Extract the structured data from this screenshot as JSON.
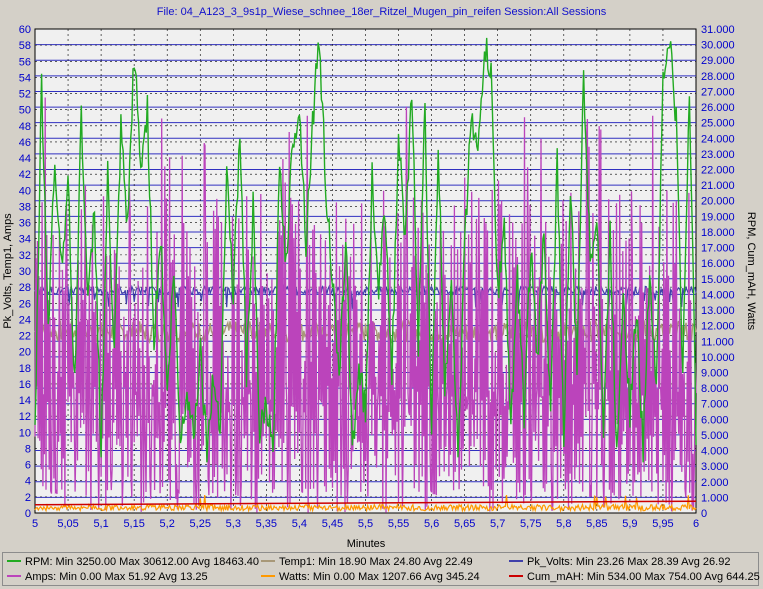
{
  "title": "File: 04_A123_3_9s1p_Wiese_schnee_18er_Ritzel_Mugen_pin_reifen   Session:All Sessions",
  "chart_data": {
    "type": "line",
    "xlabel": "Minutes",
    "ylabel_left": "Pk_Volts, Temp1, Amps",
    "ylabel_right": "RPM, Cum_mAH, Watts",
    "xlim": [
      5,
      6
    ],
    "ylim_left": [
      0,
      60
    ],
    "ylim_right": [
      0,
      31000
    ],
    "x_ticks": [
      "5",
      "5,05",
      "5,1",
      "5,15",
      "5,2",
      "5,25",
      "5,3",
      "5,35",
      "5,4",
      "5,45",
      "5,5",
      "5,55",
      "5,6",
      "5,65",
      "5,7",
      "5,75",
      "5,8",
      "5,85",
      "5,9",
      "5,95",
      "6"
    ],
    "y_left_ticks": [
      "0",
      "2",
      "4",
      "6",
      "8",
      "10",
      "12",
      "14",
      "16",
      "18",
      "20",
      "22",
      "24",
      "26",
      "28",
      "30",
      "32",
      "34",
      "36",
      "38",
      "40",
      "42",
      "44",
      "46",
      "48",
      "50",
      "52",
      "54",
      "56",
      "58",
      "60"
    ],
    "y_right_ticks": [
      "0",
      "1.000",
      "2.000",
      "3.000",
      "4.000",
      "5.000",
      "6.000",
      "7.000",
      "8.000",
      "9.000",
      "10.000",
      "11.000",
      "12.000",
      "13.000",
      "14.000",
      "15.000",
      "16.000",
      "17.000",
      "18.000",
      "19.000",
      "20.000",
      "21.000",
      "22.000",
      "23.000",
      "24.000",
      "25.000",
      "26.000",
      "27.000",
      "28.000",
      "29.000",
      "30.000",
      "31.000"
    ],
    "grid": true,
    "series": [
      {
        "name": "RPM",
        "axis": "right",
        "color": "#22aa22",
        "x": [
          5.0,
          5.01,
          5.02,
          5.03,
          5.04,
          5.05,
          5.06,
          5.07,
          5.08,
          5.09,
          5.1,
          5.11,
          5.12,
          5.13,
          5.14,
          5.15,
          5.16,
          5.17,
          5.18,
          5.19,
          5.2,
          5.21,
          5.22,
          5.23,
          5.24,
          5.25,
          5.26,
          5.27,
          5.28,
          5.29,
          5.3,
          5.31,
          5.32,
          5.33,
          5.34,
          5.35,
          5.36,
          5.37,
          5.38,
          5.39,
          5.4,
          5.41,
          5.42,
          5.43,
          5.44,
          5.45,
          5.46,
          5.47,
          5.48,
          5.49,
          5.5,
          5.51,
          5.52,
          5.53,
          5.54,
          5.55,
          5.56,
          5.57,
          5.58,
          5.59,
          5.6,
          5.61,
          5.62,
          5.63,
          5.64,
          5.65,
          5.66,
          5.67,
          5.68,
          5.69,
          5.7,
          5.71,
          5.72,
          5.73,
          5.74,
          5.75,
          5.76,
          5.77,
          5.78,
          5.79,
          5.8,
          5.81,
          5.82,
          5.83,
          5.84,
          5.85,
          5.86,
          5.87,
          5.88,
          5.89,
          5.9,
          5.91,
          5.92,
          5.93,
          5.94,
          5.95,
          5.96,
          5.97,
          5.98,
          5.99,
          6.0
        ],
        "values": [
          5000,
          27500,
          12000,
          22500,
          16000,
          21000,
          8000,
          26000,
          13000,
          19500,
          4000,
          21500,
          10000,
          24500,
          18000,
          29500,
          22000,
          26000,
          11000,
          18000,
          7500,
          15500,
          4500,
          8000,
          5000,
          10500,
          4200,
          8500,
          6000,
          22000,
          14000,
          24500,
          9000,
          19500,
          4800,
          7000,
          3500,
          22500,
          16000,
          24000,
          26000,
          17500,
          25000,
          30612,
          21000,
          15000,
          8000,
          18000,
          4000,
          9500,
          6500,
          21500,
          14500,
          19500,
          9000,
          24000,
          17000,
          27000,
          11000,
          26000,
          5500,
          23500,
          8000,
          15500,
          3250,
          17000,
          26000,
          22500,
          30000,
          28000,
          14000,
          18500,
          5500,
          15000,
          6500,
          17000,
          9500,
          18500,
          6000,
          23000,
          4500,
          21000,
          9000,
          28500,
          16000,
          19500,
          5000,
          18000,
          3800,
          14500,
          6500,
          13000,
          4000,
          16000,
          8000,
          27500,
          30500,
          25000,
          9000,
          27500,
          5000
        ]
      },
      {
        "name": "Temp1",
        "axis": "left",
        "color": "#a89878",
        "min": 18.9,
        "max": 24.8,
        "avg": 22.49
      },
      {
        "name": "Pk_Volts",
        "axis": "left",
        "color": "#4040aa",
        "min": 23.26,
        "max": 28.39,
        "avg": 26.92
      },
      {
        "name": "Amps",
        "axis": "left",
        "color": "#bb44bb",
        "min": 0.0,
        "max": 51.92,
        "avg": 13.25
      },
      {
        "name": "Watts",
        "axis": "right",
        "color": "#ff9900",
        "min": 0.0,
        "max": 1207.66,
        "avg": 345.24
      },
      {
        "name": "Cum_mAH",
        "axis": "right",
        "color": "#cc0000",
        "x": [
          5.0,
          6.0
        ],
        "values": [
          534,
          754
        ]
      }
    ]
  },
  "legend": {
    "rpm": "RPM:  Min 3250.00 Max 30612.00 Avg 18463.40",
    "temp1": "Temp1:  Min 18.90 Max 24.80 Avg 22.49",
    "pk_volts": "Pk_Volts:  Min 23.26 Max 28.39 Avg 26.92",
    "amps": "Amps:  Min 0.00 Max 51.92 Avg 13.25",
    "watts": "Watts:  Min 0.00 Max 1207.66 Avg 345.24",
    "cum_mah": "Cum_mAH:  Min 534.00 Max 754.00 Avg 644.25"
  }
}
